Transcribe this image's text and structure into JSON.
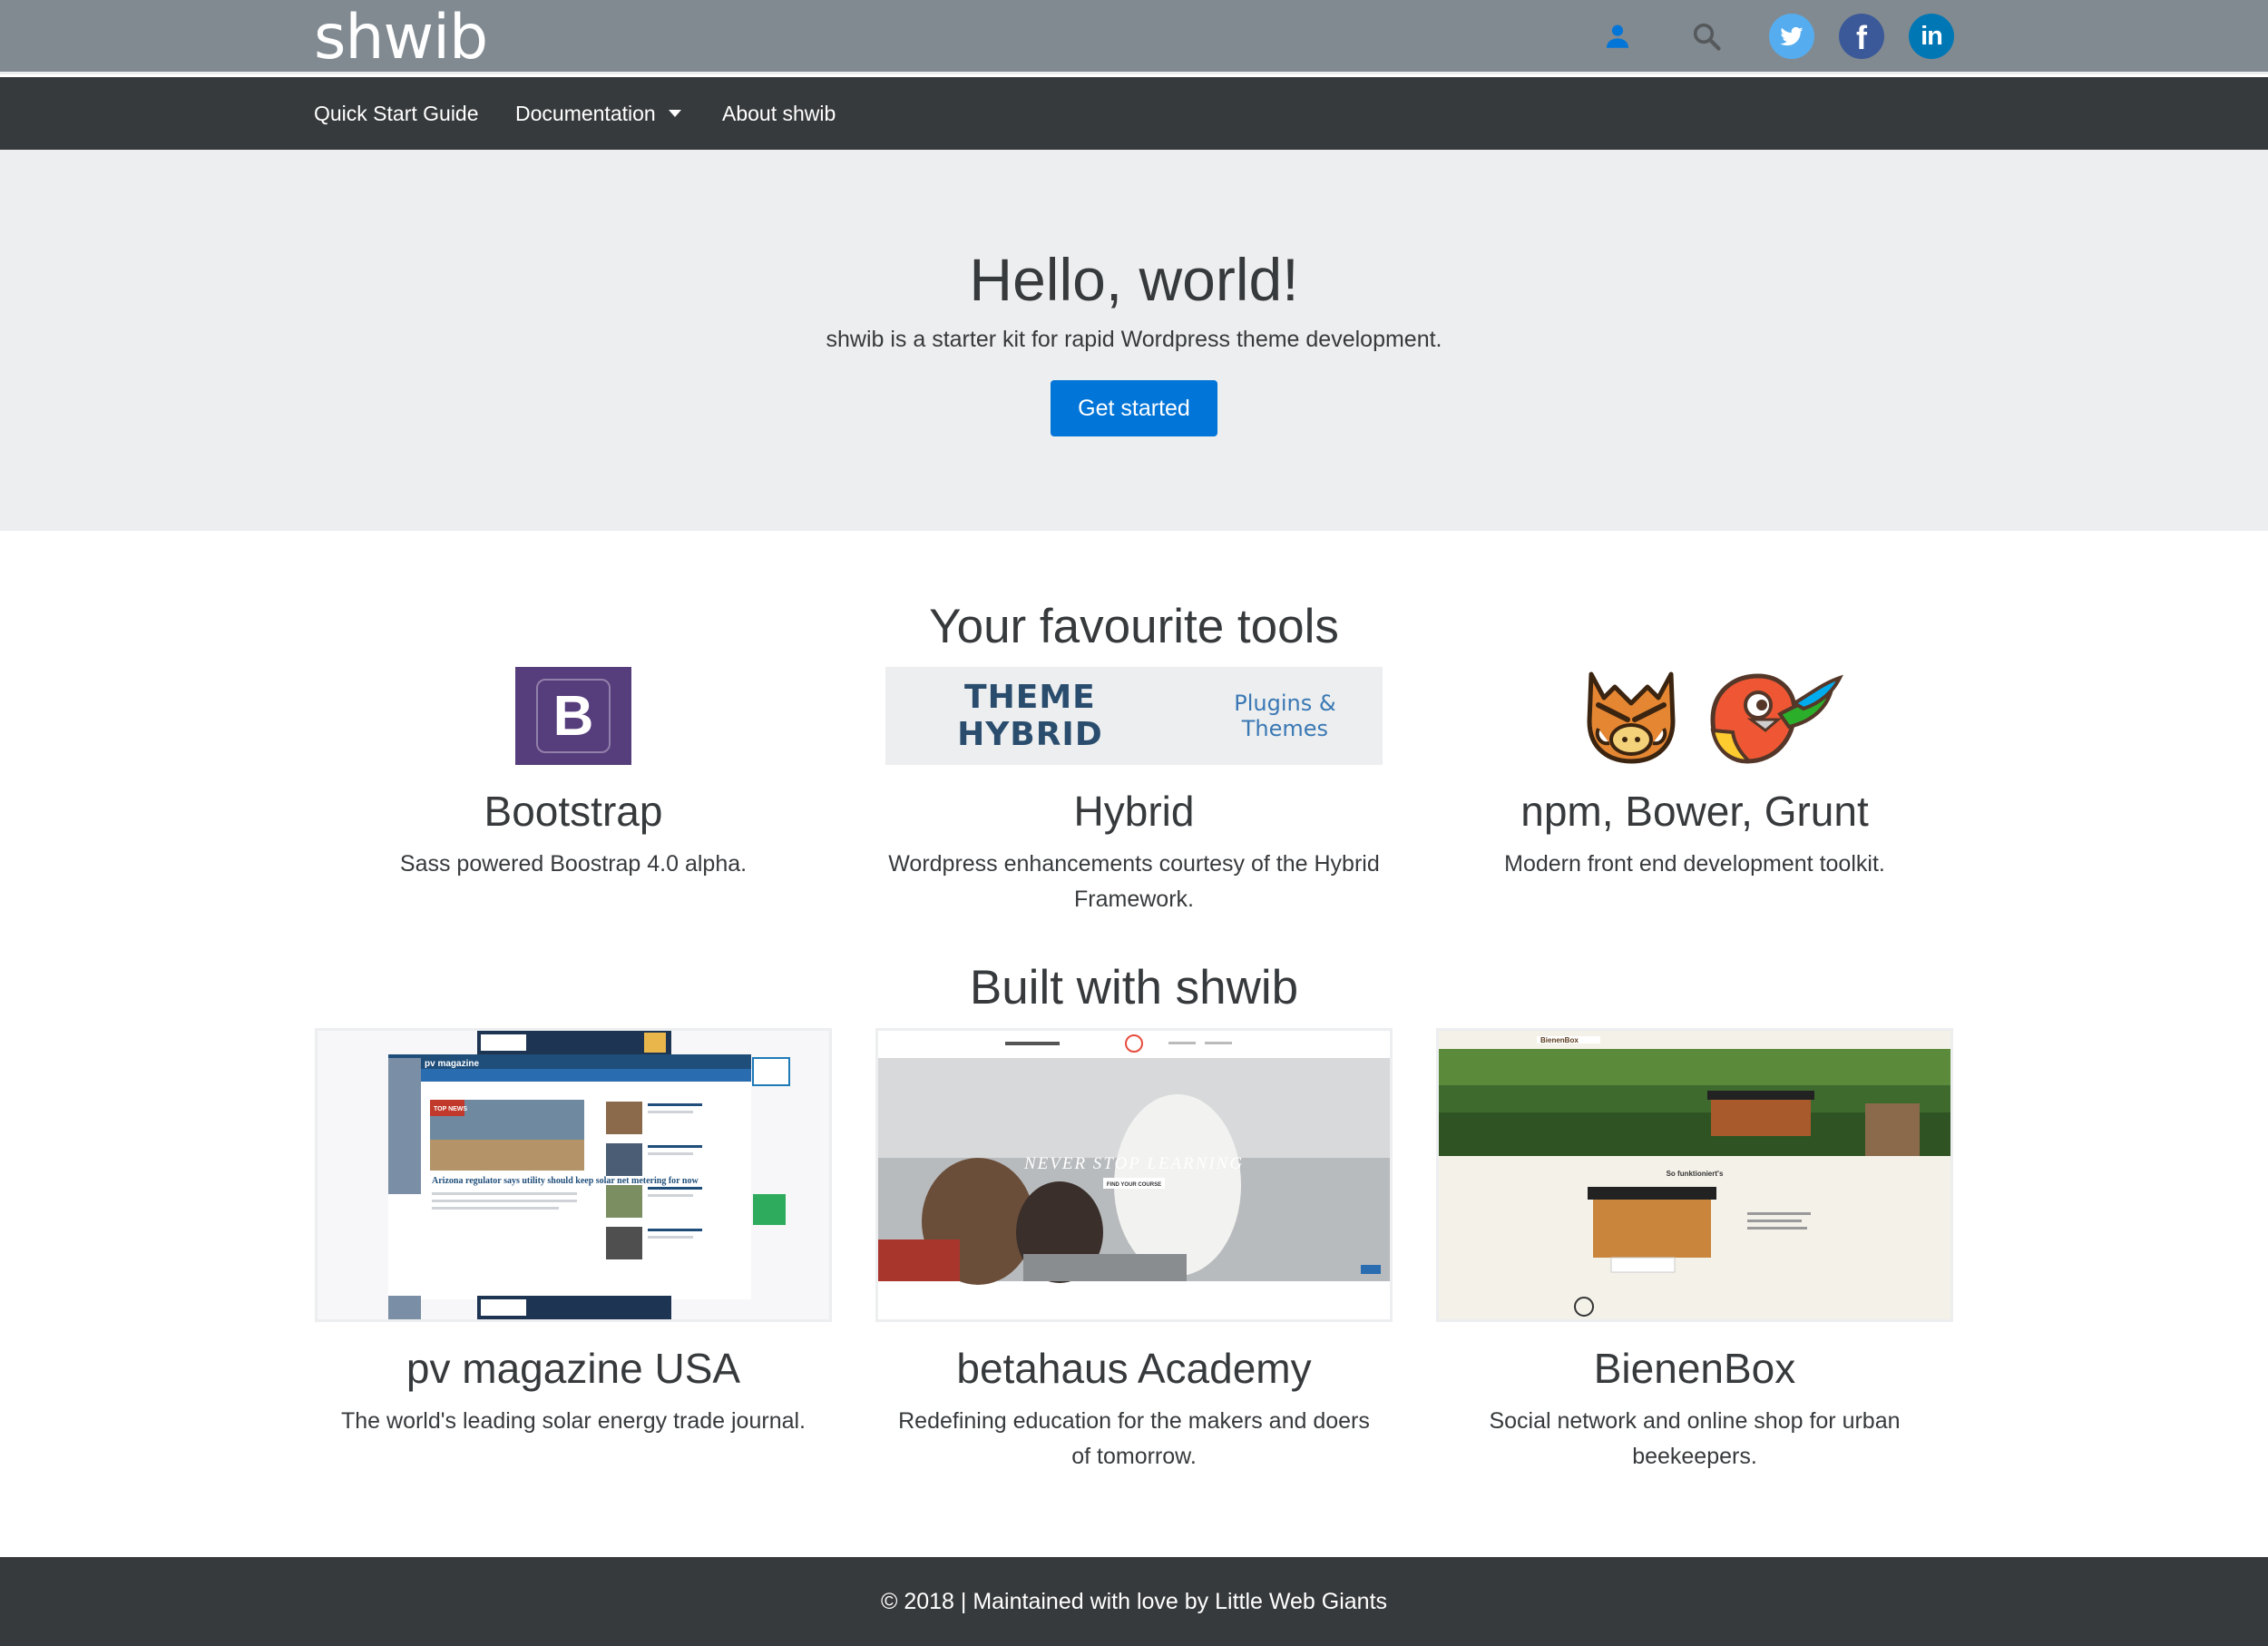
{
  "brand": "shwib",
  "header_icons": {
    "user": "user-icon",
    "search": "search-icon",
    "twitter": "twitter-icon",
    "facebook": "facebook-icon",
    "facebook_glyph": "f",
    "linkedin": "linkedin-icon",
    "linkedin_glyph": "in",
    "colors": {
      "twitter": "#55acee",
      "facebook": "#3b5998",
      "linkedin": "#0077b5",
      "user": "#0275d8"
    }
  },
  "nav": {
    "items": [
      {
        "label": "Quick Start Guide"
      },
      {
        "label": "Documentation"
      },
      {
        "label": "About shwib"
      }
    ]
  },
  "hero": {
    "title": "Hello, world!",
    "subtitle": "shwib is a starter kit for rapid Wordpress theme development.",
    "button": "Get started",
    "accent": "#0275d8"
  },
  "tools": {
    "title": "Your favourite tools",
    "items": [
      {
        "name": "Bootstrap",
        "description": "Sass powered Boostrap 4.0 alpha.",
        "logo_text": "B"
      },
      {
        "name": "Hybrid",
        "description": "Wordpress enhancements courtesy of the Hybrid Framework.",
        "logo_bold": "THEME HYBRID",
        "logo_sub": "Plugins & Themes"
      },
      {
        "name": "npm, Bower, Grunt",
        "description": "Modern front end development toolkit."
      }
    ]
  },
  "built": {
    "title": "Built with shwib",
    "items": [
      {
        "name": "pv magazine USA",
        "description": "The world's leading solar energy trade journal.",
        "shot_brand": "pv magazine",
        "shot_headline": "Arizona regulator says utility should keep solar net metering for now",
        "shot_tag": "TOP NEWS"
      },
      {
        "name": "betahaus Academy",
        "description": "Redefining education for the makers and doers of tomorrow.",
        "shot_tagline": "NEVER STOP LEARNING",
        "shot_button": "FIND YOUR COURSE"
      },
      {
        "name": "BienenBox",
        "description": "Social network and online shop for urban beekeepers.",
        "shot_brand": "BienenBox",
        "shot_heading": "So funktioniert's"
      }
    ]
  },
  "footer": {
    "text": "© 2018 | Maintained with love by Little Web Giants"
  }
}
